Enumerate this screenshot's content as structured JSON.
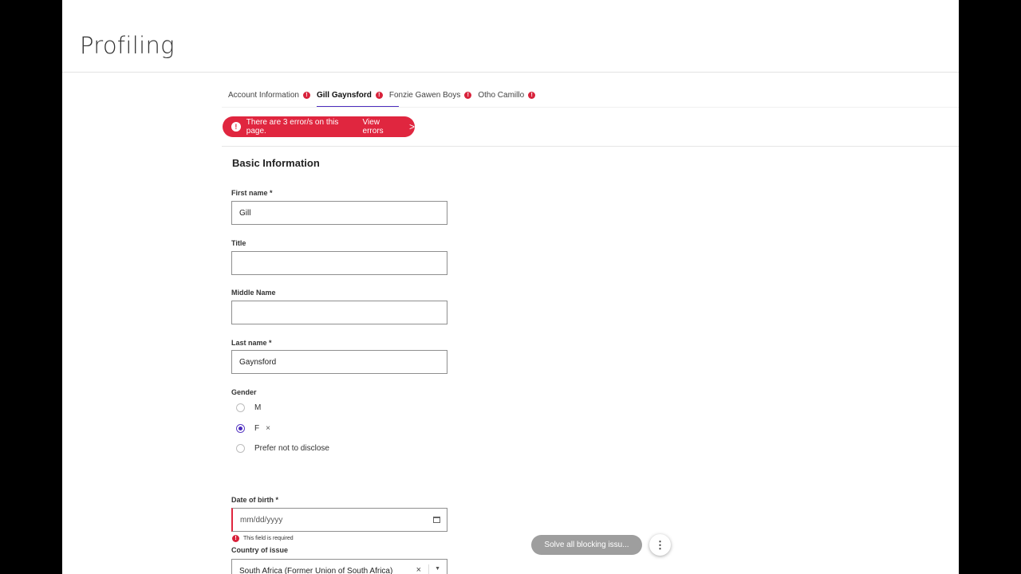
{
  "page": {
    "title": "Profiling"
  },
  "tabs": [
    {
      "label": "Account Information",
      "active": false,
      "has_error": true
    },
    {
      "label": "Gill Gaynsford",
      "active": true,
      "has_error": true
    },
    {
      "label": "Fonzie Gawen Boys",
      "active": false,
      "has_error": true
    },
    {
      "label": "Otho Camillo",
      "active": false,
      "has_error": true
    }
  ],
  "error_banner": {
    "icon": "!",
    "text": "There are 3 error/s on this page.",
    "link": "View errors",
    "chevron": ">"
  },
  "section": {
    "title": "Basic Information"
  },
  "fields": {
    "first_name": {
      "label": "First name *",
      "value": "Gill"
    },
    "title": {
      "label": "Title",
      "value": ""
    },
    "middle_name": {
      "label": "Middle Name",
      "value": ""
    },
    "last_name": {
      "label": "Last name *",
      "value": "Gaynsford"
    },
    "gender": {
      "label": "Gender",
      "options": [
        "M",
        "F",
        "Prefer not to disclose"
      ],
      "selected": "F",
      "clear": "×"
    },
    "date_of_birth": {
      "label": "Date of birth *",
      "placeholder": "mm/dd/yyyy",
      "error": "This field is required",
      "error_icon": "!"
    },
    "country_of_issue": {
      "label": "Country of issue",
      "value": "South Africa (Former Union of South Africa)",
      "clear": "×",
      "caret": "▼"
    }
  },
  "footer": {
    "solve_button": "Solve all blocking issu...",
    "more_icon": "⋮"
  },
  "colors": {
    "accent": "#4b2bbd",
    "error": "#e0263f",
    "disabled": "#9e9e9e"
  }
}
